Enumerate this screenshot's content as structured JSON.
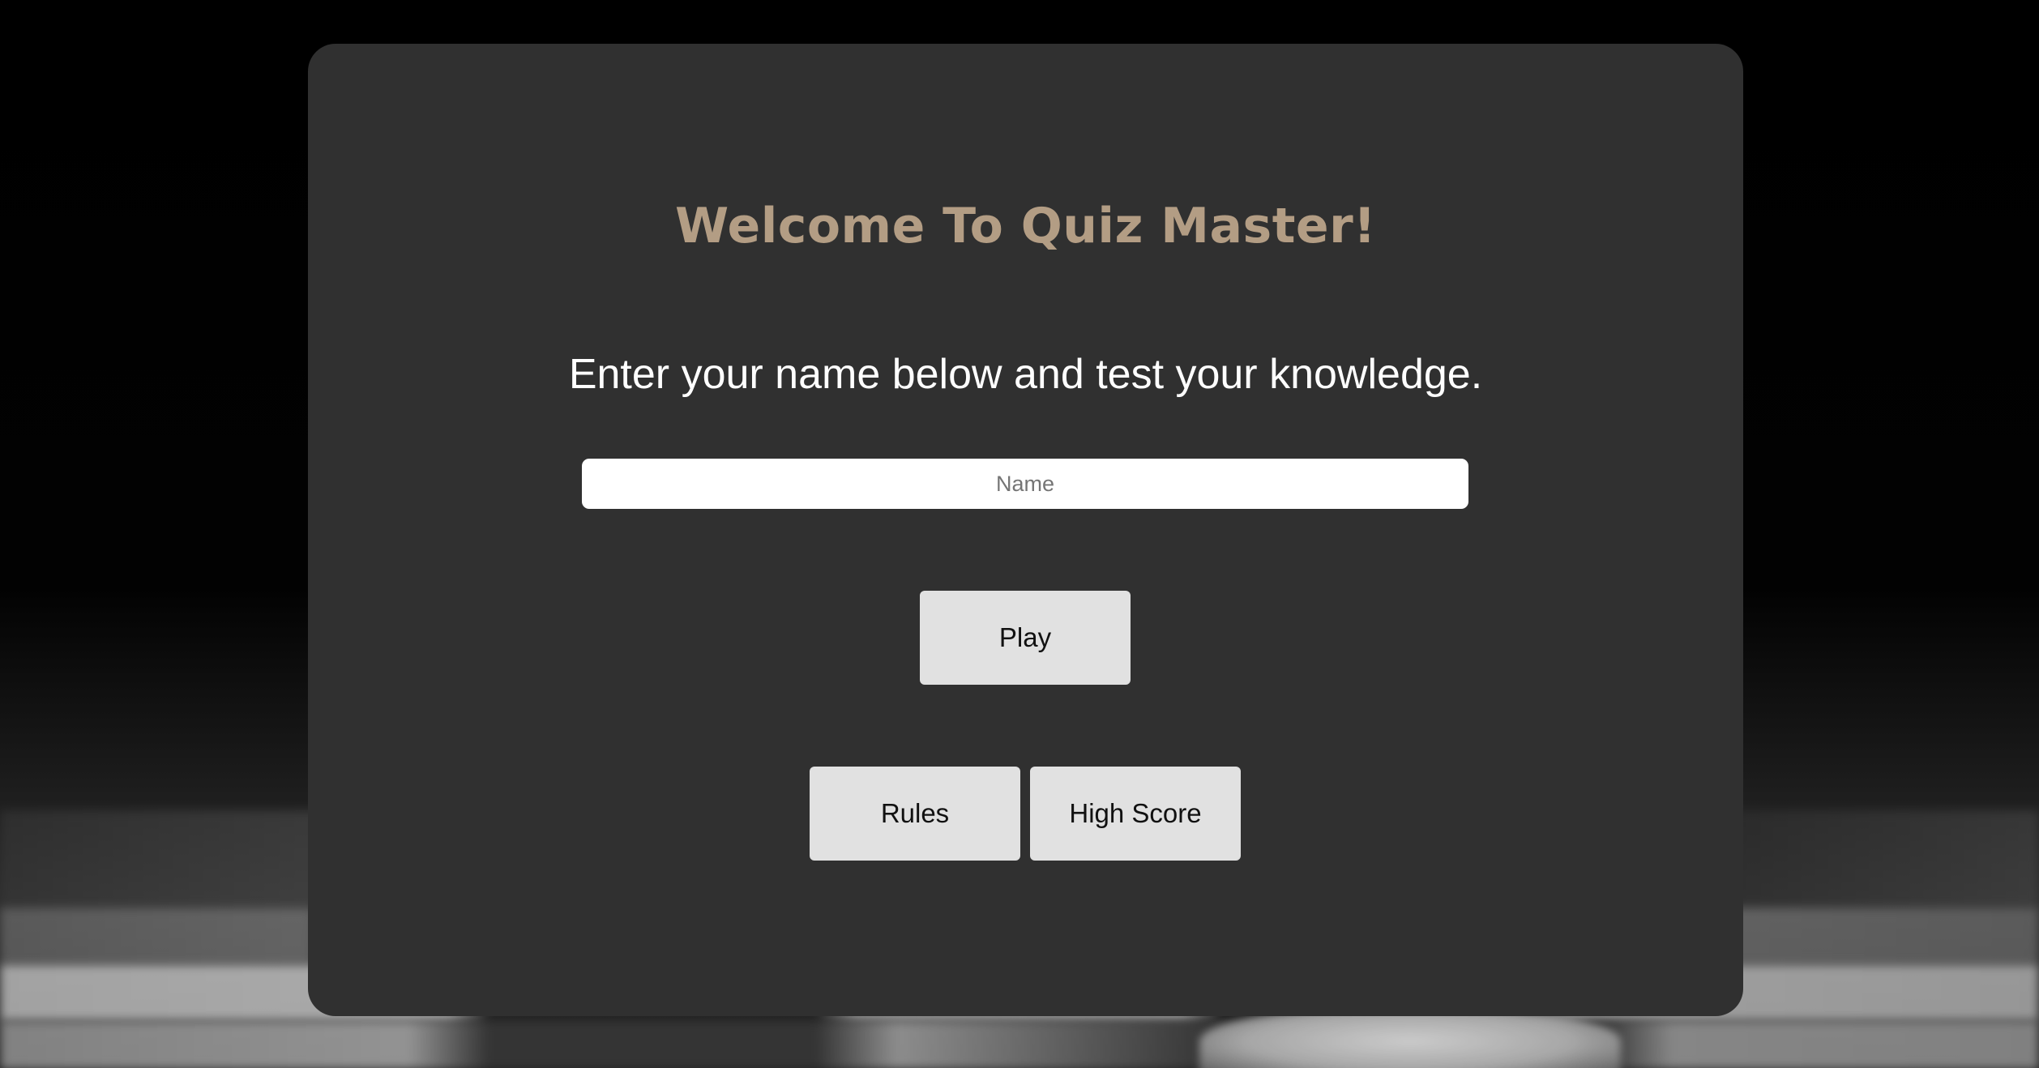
{
  "app": {
    "title": "Welcome To Quiz Master!",
    "subtitle": "Enter your name below and test your knowledge."
  },
  "form": {
    "name_placeholder": "Name",
    "name_value": ""
  },
  "buttons": {
    "play_label": "Play",
    "rules_label": "Rules",
    "high_score_label": "High Score"
  },
  "colors": {
    "card_background": "#303030",
    "title_color": "#b39d84",
    "button_background": "#e1e1e1"
  }
}
